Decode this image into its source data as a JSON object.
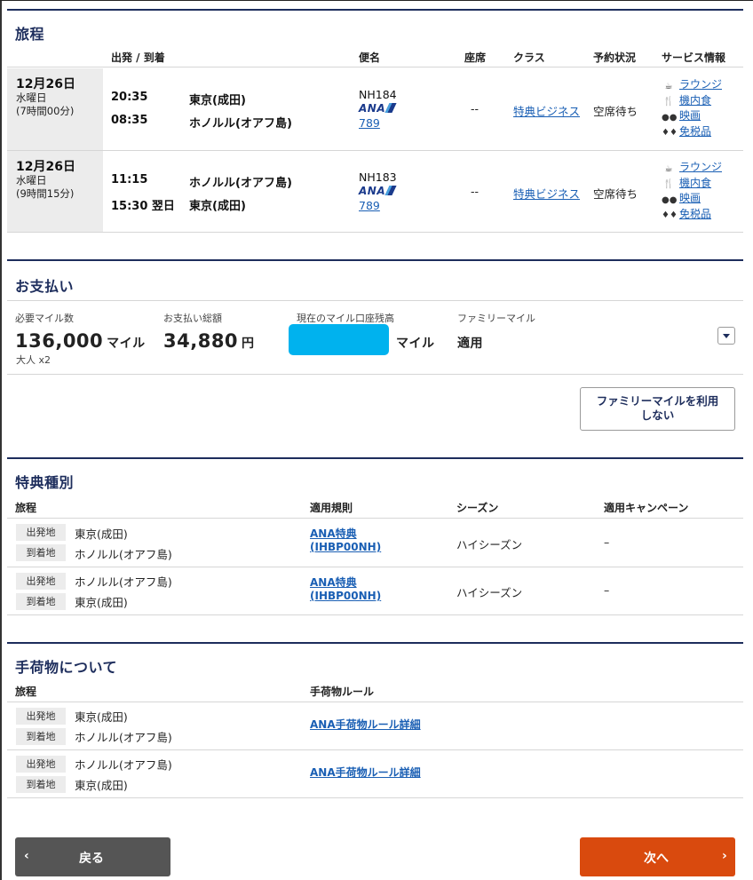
{
  "itinerary": {
    "title": "旅程",
    "headers": {
      "dep_arr": "出発 / 到着",
      "flight": "便名",
      "seat": "座席",
      "class": "クラス",
      "status": "予約状況",
      "service": "サービス情報"
    },
    "rows": [
      {
        "date": "12月26日",
        "weekday": "水曜日",
        "duration": "(7時間00分)",
        "dep_time": "20:35",
        "dep_place": "東京(成田)",
        "arr_time": "08:35",
        "arr_place": "ホノルル(オアフ島)",
        "flight_no": "NH184",
        "airline": "ANA",
        "aircraft": "789",
        "seat": "--",
        "class": "特典ビジネス",
        "status": "空席待ち",
        "services": [
          "ラウンジ",
          "機内食",
          "映画",
          "免税品"
        ]
      },
      {
        "date": "12月26日",
        "weekday": "水曜日",
        "duration": "(9時間15分)",
        "dep_time": "11:15",
        "dep_place": "ホノルル(オアフ島)",
        "arr_time": "15:30 翌日",
        "arr_place": "東京(成田)",
        "flight_no": "NH183",
        "airline": "ANA",
        "aircraft": "789",
        "seat": "--",
        "class": "特典ビジネス",
        "status": "空席待ち",
        "services": [
          "ラウンジ",
          "機内食",
          "映画",
          "免税品"
        ]
      }
    ]
  },
  "payment": {
    "title": "お支払い",
    "miles_label": "必要マイル数",
    "miles_value": "136,000",
    "miles_unit": "マイル",
    "pax": "大人 x2",
    "total_label": "お支払い総額",
    "total_value": "34,880",
    "total_unit": "円",
    "balance_label": "現在のマイル口座残高",
    "balance_unit": "マイル",
    "family_label": "ファミリーマイル",
    "family_value": "適用",
    "family_button_line1": "ファミリーマイルを利用",
    "family_button_line2": "しない"
  },
  "award": {
    "title": "特典種別",
    "headers": {
      "itinerary": "旅程",
      "rule": "適用規則",
      "season": "シーズン",
      "campaign": "適用キャンペーン"
    },
    "rows": [
      {
        "dep_tag": "出発地",
        "dep": "東京(成田)",
        "arr_tag": "到着地",
        "arr": "ホノルル(オアフ島)",
        "rule_line1": "ANA特典",
        "rule_line2": "(IHBP00NH)",
        "season": "ハイシーズン",
        "campaign": "–"
      },
      {
        "dep_tag": "出発地",
        "dep": "ホノルル(オアフ島)",
        "arr_tag": "到着地",
        "arr": "東京(成田)",
        "rule_line1": "ANA特典",
        "rule_line2": "(IHBP00NH)",
        "season": "ハイシーズン",
        "campaign": "–"
      }
    ]
  },
  "baggage": {
    "title": "手荷物について",
    "headers": {
      "itinerary": "旅程",
      "rule": "手荷物ルール"
    },
    "rows": [
      {
        "dep_tag": "出発地",
        "dep": "東京(成田)",
        "arr_tag": "到着地",
        "arr": "ホノルル(オアフ島)",
        "link": "ANA手荷物ルール詳細"
      },
      {
        "dep_tag": "出発地",
        "dep": "ホノルル(オアフ島)",
        "arr_tag": "到着地",
        "arr": "東京(成田)",
        "link": "ANA手荷物ルール詳細"
      }
    ]
  },
  "nav": {
    "back": "戻る",
    "next": "次へ"
  },
  "colors": {
    "brand_navy": "#1d2d5c",
    "link_blue": "#1a5fb4",
    "next_orange": "#d94a0e",
    "back_gray": "#555555",
    "redaction": "#00b2ee"
  },
  "icons": [
    "lounge-icon",
    "meal-icon",
    "movie-icon",
    "dutyfree-icon",
    "chevron-left-icon",
    "chevron-right-icon",
    "dropdown-icon"
  ]
}
